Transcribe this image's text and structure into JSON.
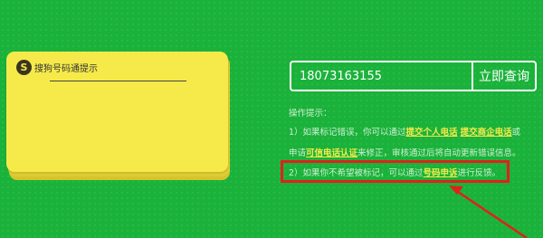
{
  "card": {
    "title": "搜狗号码通提示"
  },
  "search": {
    "value": "18073163155",
    "button_label": "立即查询"
  },
  "tips": {
    "heading": "操作提示：",
    "line1": {
      "prefix": "1）如果标记错误，你可以通过",
      "link1": "提交个人电话",
      "link2": "提交商企电话",
      "suffix": "或"
    },
    "line2": {
      "prefix": "申请",
      "link": "可信电话认证",
      "suffix": "来修正，审核通过后将自动更新错误信息。"
    },
    "line3": {
      "prefix": "2）如果你不希望被标记，可以通过",
      "link": "号码申诉",
      "suffix": "进行反馈。"
    }
  },
  "colors": {
    "background": "#1ab23a",
    "card": "#f5ea4a",
    "link": "#f5ea4a",
    "highlight": "#e0211b"
  }
}
